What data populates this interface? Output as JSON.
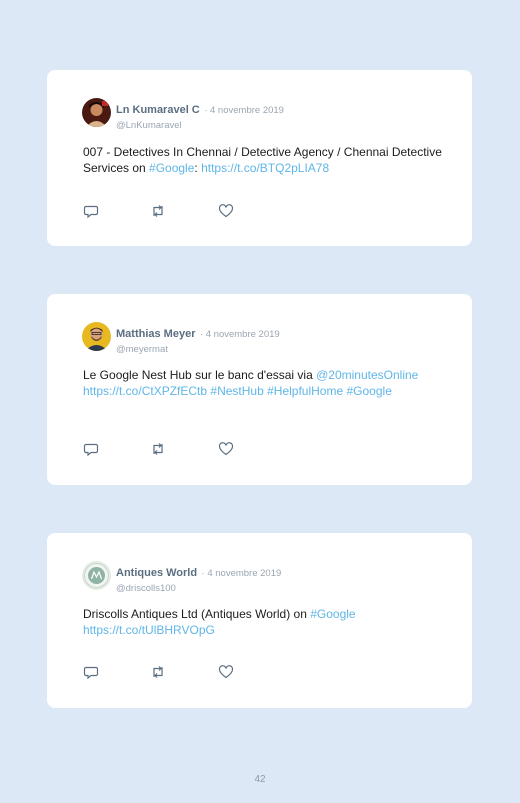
{
  "tweets": [
    {
      "name": "Ln Kumaravel C",
      "date": "· 4 novembre 2019",
      "handle": "@LnKumaravel",
      "segments": [
        {
          "text": "007 - Detectives In Chennai / Detective Agency / Chennai Detective Services on ",
          "link": false
        },
        {
          "text": "#Google",
          "link": true
        },
        {
          "text": ": ",
          "link": false
        },
        {
          "text": "https://t.co/BTQ2pLIA78",
          "link": true
        }
      ]
    },
    {
      "name": "Matthias Meyer",
      "date": "· 4 novembre 2019",
      "handle": "@meyermat",
      "segments": [
        {
          "text": "Le Google Nest Hub sur le banc d'essai via ",
          "link": false
        },
        {
          "text": "@20minutesOnline",
          "link": true
        },
        {
          "text": " ",
          "link": false
        },
        {
          "text": "https://t.co/CtXPZfECtb",
          "link": true
        },
        {
          "text": " ",
          "link": false
        },
        {
          "text": "#NestHub",
          "link": true
        },
        {
          "text": " ",
          "link": false
        },
        {
          "text": "#HelpfulHome",
          "link": true
        },
        {
          "text": " ",
          "link": false
        },
        {
          "text": "#Google",
          "link": true
        }
      ]
    },
    {
      "name": "Antiques World",
      "date": "· 4 novembre 2019",
      "handle": "@driscolls100",
      "segments": [
        {
          "text": "Driscolls Antiques Ltd (Antiques World) on ",
          "link": false
        },
        {
          "text": "#Google",
          "link": true
        },
        {
          "text": " ",
          "link": false
        },
        {
          "text": "https://t.co/tUlBHRVOpG",
          "link": true
        }
      ]
    }
  ],
  "icons": [
    "reply-icon",
    "retweet-icon",
    "like-icon"
  ],
  "colors": {
    "background": "#dce8f6",
    "card": "#ffffff",
    "link": "#5fb6e8",
    "name": "#5b6e81",
    "muted": "#9aa6b2"
  },
  "page_number": "42"
}
